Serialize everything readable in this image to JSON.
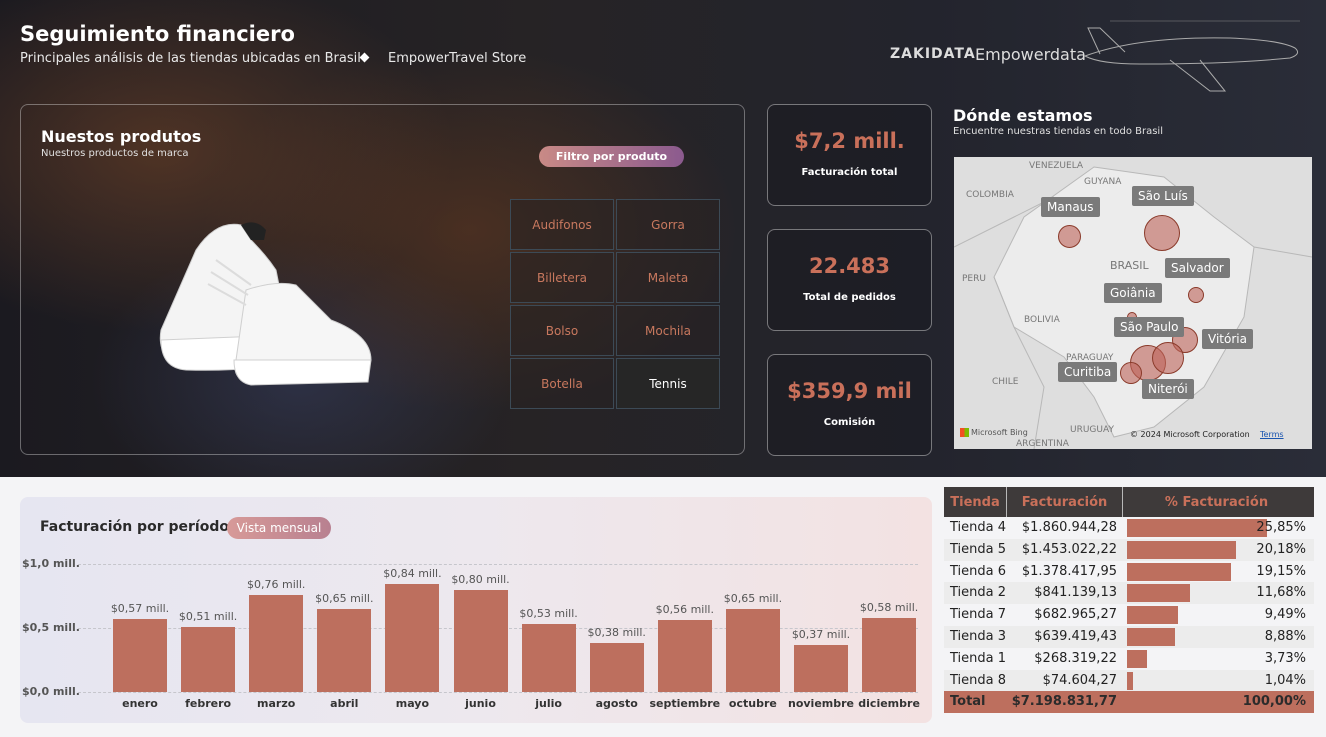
{
  "header": {
    "title": "Seguimiento financiero",
    "subtitle": "Principales análisis de las tiendas ubicadas en Brasil",
    "store": "EmpowerTravel Store",
    "logo_brand": "ZAKIDATA",
    "logo_name": "Empowerdata"
  },
  "products": {
    "title": "Nuestos produtos",
    "subtitle": "Nuestros productos de marca",
    "filter_label": "Filtro por produto",
    "items": [
      "Audifonos",
      "Gorra",
      "Billetera",
      "Maleta",
      "Bolso",
      "Mochila",
      "Botella",
      "Tennis"
    ],
    "selected": "Tennis"
  },
  "kpis": [
    {
      "value": "$7,2 mill.",
      "label": "Facturación total"
    },
    {
      "value": "22.483",
      "label": "Total de pedidos"
    },
    {
      "value": "$359,9 mil",
      "label": "Comisión"
    }
  ],
  "map": {
    "title": "Dónde estamos",
    "subtitle": "Encuentre nuestras tiendas en todo Brasil",
    "cities": [
      "Manaus",
      "São Luís",
      "Salvador",
      "Goiânia",
      "São Paulo",
      "Vitória",
      "Curitiba",
      "Niterói"
    ],
    "countries": [
      "VENEZUELA",
      "GUYANA",
      "COLOMBIA",
      "BRASIL",
      "PERU",
      "BOLIVIA",
      "PARAGUAY",
      "CHILE",
      "ARGENTINA",
      "URUGUAY"
    ],
    "bing": "Microsoft Bing",
    "copyright": "© 2024 Microsoft Corporation",
    "terms": "Terms"
  },
  "period": {
    "title": "Facturación por período",
    "view_label": "Vista mensual"
  },
  "chart_data": {
    "type": "bar",
    "categories": [
      "enero",
      "febrero",
      "marzo",
      "abril",
      "mayo",
      "junio",
      "julio",
      "agosto",
      "septiembre",
      "octubre",
      "noviembre",
      "diciembre"
    ],
    "values": [
      0.57,
      0.51,
      0.76,
      0.65,
      0.84,
      0.8,
      0.53,
      0.38,
      0.56,
      0.65,
      0.37,
      0.58
    ],
    "labels": [
      "$0,57 mill.",
      "$0,51 mill.",
      "$0,76 mill.",
      "$0,65 mill.",
      "$0,84 mill.",
      "$0,80 mill.",
      "$0,53 mill.",
      "$0,38 mill.",
      "$0,56 mill.",
      "$0,65 mill.",
      "$0,37 mill.",
      "$0,58 mill."
    ],
    "yticks": [
      "$1,0 mill.",
      "$0,5 mill.",
      "$0,0 mill."
    ],
    "ylim": [
      0,
      1.0
    ],
    "color": "#bd6f5e"
  },
  "table": {
    "headers": [
      "Tienda",
      "Facturación",
      "% Facturación"
    ],
    "rows": [
      {
        "tienda": "Tienda 4",
        "fact": "$1.860.944,28",
        "pct": "25,85%",
        "share": 25.85
      },
      {
        "tienda": "Tienda 5",
        "fact": "$1.453.022,22",
        "pct": "20,18%",
        "share": 20.18
      },
      {
        "tienda": "Tienda 6",
        "fact": "$1.378.417,95",
        "pct": "19,15%",
        "share": 19.15
      },
      {
        "tienda": "Tienda 2",
        "fact": "$841.139,13",
        "pct": "11,68%",
        "share": 11.68
      },
      {
        "tienda": "Tienda 7",
        "fact": "$682.965,27",
        "pct": "9,49%",
        "share": 9.49
      },
      {
        "tienda": "Tienda 3",
        "fact": "$639.419,43",
        "pct": "8,88%",
        "share": 8.88
      },
      {
        "tienda": "Tienda 1",
        "fact": "$268.319,22",
        "pct": "3,73%",
        "share": 3.73
      },
      {
        "tienda": "Tienda 8",
        "fact": "$74.604,27",
        "pct": "1,04%",
        "share": 1.04
      }
    ],
    "total": {
      "tienda": "Total",
      "fact": "$7.198.831,77",
      "pct": "100,00%"
    }
  }
}
